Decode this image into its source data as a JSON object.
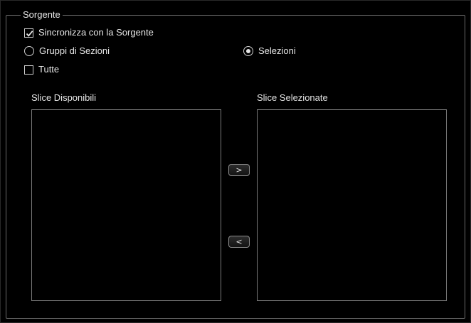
{
  "group": {
    "title": "Sorgente"
  },
  "options": {
    "sync_label": "Sincronizza con la Sorgente",
    "sync_checked": true,
    "radio_groups_label": "Gruppi di Sezioni",
    "radio_selections_label": "Selezioni",
    "selected_radio": "Selezioni",
    "all_label": "Tutte",
    "all_checked": false
  },
  "available": {
    "label": "Slice Disponibili",
    "items": []
  },
  "selected": {
    "label": "Slice Selezionate",
    "items": []
  },
  "buttons": {
    "add_label": ">",
    "remove_label": "<"
  },
  "colors": {
    "background": "#000000",
    "frame_border": "#6a6a6a",
    "text": "#e6e6e6"
  }
}
